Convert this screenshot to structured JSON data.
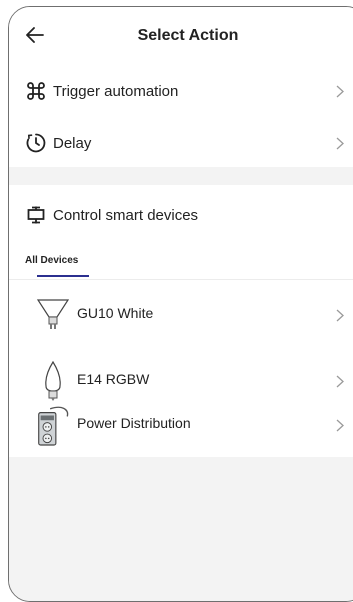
{
  "header": {
    "title": "Select Action"
  },
  "actions": [
    {
      "label": "Trigger automation",
      "icon": "command-icon"
    },
    {
      "label": "Delay",
      "icon": "timer-icon"
    }
  ],
  "control": {
    "label": "Control smart devices",
    "icon": "smart-device-icon"
  },
  "tabs": [
    {
      "label": "All Devices",
      "active": true
    }
  ],
  "devices": [
    {
      "name": "GU10 White",
      "icon": "spotlight-bulb-icon"
    },
    {
      "name": "E14 RGBW",
      "icon": "candle-bulb-icon"
    },
    {
      "name": "Power Distribution",
      "icon": "power-strip-icon"
    }
  ],
  "colors": {
    "accent": "#2b2f8f",
    "separator": "#f3f3f3",
    "text": "#222222",
    "chevron": "#9a9a9a"
  }
}
